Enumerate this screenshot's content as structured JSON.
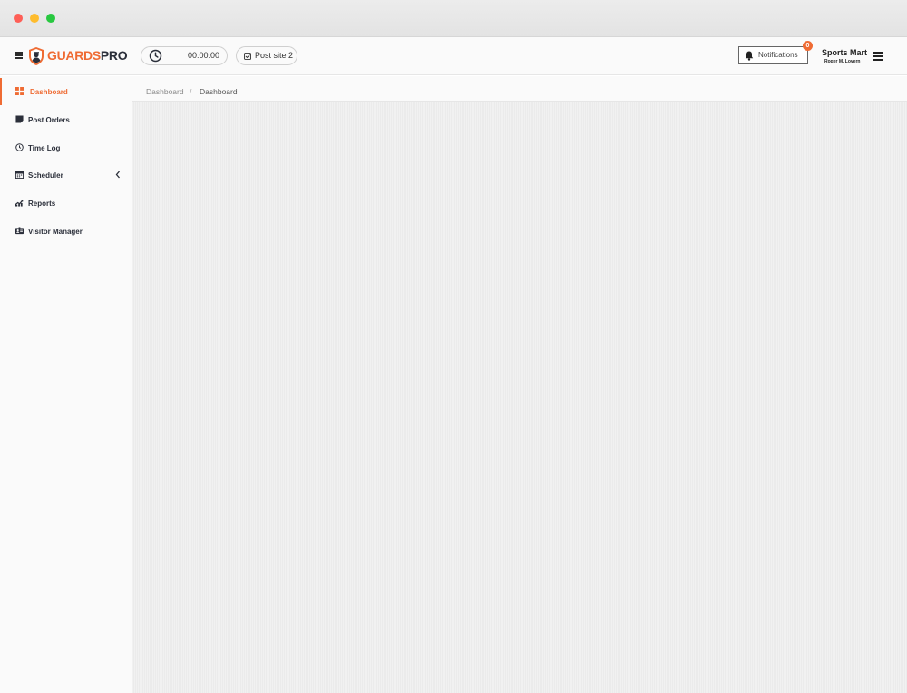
{
  "colors": {
    "accent": "#ef6b33",
    "text_dark": "#2b2f3a"
  },
  "brand": {
    "part1": "GUARDS",
    "part2": "PRO"
  },
  "header": {
    "timer": "00:00:00",
    "post_site": "Post site 2",
    "notifications_label": "Notifications",
    "notifications_count": "0",
    "company": "Sports Mart",
    "user": "Roger M. Lovern"
  },
  "sidebar": {
    "items": [
      {
        "label": "Dashboard",
        "icon": "dashboard-grid-icon",
        "active": true
      },
      {
        "label": "Post Orders",
        "icon": "note-icon"
      },
      {
        "label": "Time Log",
        "icon": "clock-icon"
      },
      {
        "label": "Scheduler",
        "icon": "calendar-icon",
        "has_submenu": true
      },
      {
        "label": "Reports",
        "icon": "chart-icon"
      },
      {
        "label": "Visitor Manager",
        "icon": "id-card-icon"
      }
    ]
  },
  "breadcrumb": {
    "items": [
      "Dashboard",
      "Dashboard"
    ],
    "separator": "/"
  }
}
